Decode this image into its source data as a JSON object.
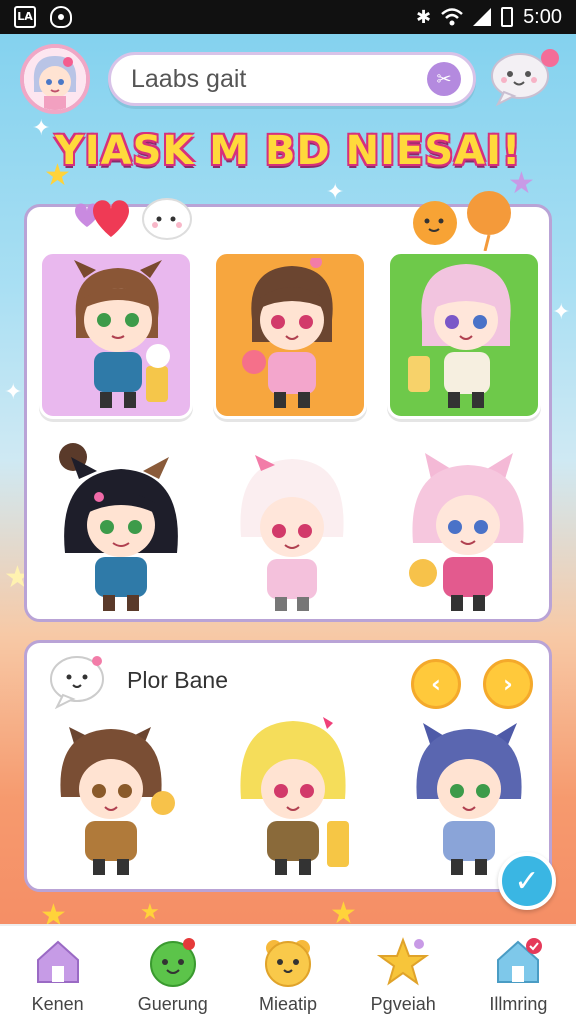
{
  "status_bar": {
    "time": "5:00",
    "left_icons": [
      "app-icon",
      "ghost-icon"
    ],
    "right_icons": [
      "bluetooth-icon",
      "wifi-icon",
      "signal-icon",
      "battery-icon"
    ]
  },
  "header": {
    "search_placeholder": "Laabs gait",
    "title": "YIASK M BD NIESAI!"
  },
  "colors": {
    "accent_purple": "#b48adf",
    "accent_yellow": "#ffc93b",
    "check_blue": "#3ab6e3",
    "card_lavender": "#e9b8ee",
    "card_orange": "#f7a63e",
    "card_green": "#6ec94a"
  },
  "main_grid": {
    "characters": [
      {
        "name": "brown-hair-cat-ear-girl",
        "card": "lavender"
      },
      {
        "name": "brown-hair-pink-dress-girl",
        "card": "orange"
      },
      {
        "name": "pink-hair-drink-girl",
        "card": "green"
      },
      {
        "name": "black-hair-cat-ear-girl",
        "card": "none"
      },
      {
        "name": "white-hair-pink-girl",
        "card": "none"
      },
      {
        "name": "pink-hair-cat-ear-girl",
        "card": "none"
      }
    ]
  },
  "bottom_panel": {
    "heading": "Plor Bane",
    "characters": [
      "brown-hair-boy",
      "blonde-hair-girl",
      "blue-hair-cat-girl"
    ]
  },
  "bottom_nav": {
    "items": [
      {
        "label": "Kenen",
        "icon": "house-icon"
      },
      {
        "label": "Guerung",
        "icon": "green-face-icon"
      },
      {
        "label": "Mieatip",
        "icon": "bear-face-icon"
      },
      {
        "label": "Pgveiah",
        "icon": "star-icon"
      },
      {
        "label": "Illmring",
        "icon": "home-badge-icon"
      }
    ]
  }
}
